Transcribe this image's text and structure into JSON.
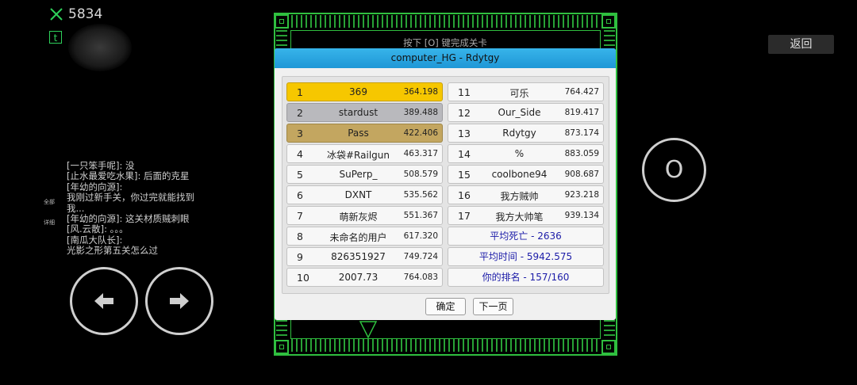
{
  "hud": {
    "score": "5834",
    "t_label": "t"
  },
  "chat": {
    "side_labels": [
      "全部",
      "详细"
    ],
    "lines": [
      "[一只笨手呢]: 没",
      "[止水最爱吃水果]: 后面的克星",
      "[年幼的向源]:",
      "我刚过新手关，你过完就能找到我...",
      "[年幼的向源]: 这关材质贼刺眼",
      "[风.云散]: 。。。",
      "[南瓜大队长]:",
      "光影之形第五关怎么过"
    ]
  },
  "controls": {
    "action_label": "O"
  },
  "back_button": "返回",
  "hint": "按下 [O] 键完成关卡",
  "dialog": {
    "title": "computer_HG - Rdytgy",
    "left_rows": [
      {
        "rank": "1",
        "name": "369",
        "time": "364.198"
      },
      {
        "rank": "2",
        "name": "stardust",
        "time": "389.488"
      },
      {
        "rank": "3",
        "name": "Pass",
        "time": "422.406"
      },
      {
        "rank": "4",
        "name": "冰袋#Railgun",
        "time": "463.317"
      },
      {
        "rank": "5",
        "name": "SuPerp_",
        "time": "508.579"
      },
      {
        "rank": "6",
        "name": "DXNT",
        "time": "535.562"
      },
      {
        "rank": "7",
        "name": "萌新灰烬",
        "time": "551.367"
      },
      {
        "rank": "8",
        "name": "未命名的用户",
        "time": "617.320"
      },
      {
        "rank": "9",
        "name": "826351927",
        "time": "749.724"
      },
      {
        "rank": "10",
        "name": "2007.73",
        "time": "764.083"
      }
    ],
    "right_rows": [
      {
        "rank": "11",
        "name": "可乐",
        "time": "764.427"
      },
      {
        "rank": "12",
        "name": "Our_Side",
        "time": "819.417"
      },
      {
        "rank": "13",
        "name": "Rdytgy",
        "time": "873.174"
      },
      {
        "rank": "14",
        "name": "%",
        "time": "883.059"
      },
      {
        "rank": "15",
        "name": "coolbone94",
        "time": "908.687"
      },
      {
        "rank": "16",
        "name": "我方贼帅",
        "time": "923.218"
      },
      {
        "rank": "17",
        "name": "我方大帅笔",
        "time": "939.134"
      }
    ],
    "stats": [
      "平均死亡 - 2636",
      "平均时间 - 5942.575",
      "你的排名 - 157/160"
    ],
    "confirm": "确定",
    "next_page": "下一页"
  },
  "colors": {
    "gold": "#f6c700",
    "silver": "#b9b9bd",
    "bronze": "#c3a660",
    "frame": "#2fbf3f",
    "title_bar": "#1f97d6",
    "stat_text": "#1c1ca8"
  }
}
